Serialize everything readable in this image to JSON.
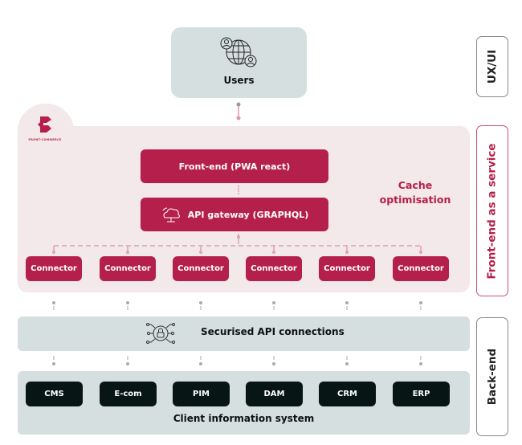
{
  "colors": {
    "brand": "#b51f4b",
    "brand_panel": "#f3e8ea",
    "neutral_panel": "#d5dfdf",
    "system_box": "#071514"
  },
  "layers": {
    "ux": "UX/UI",
    "front": "Front-end as a service",
    "back": "Back-end"
  },
  "users": {
    "label": "Users",
    "icon": "globe-users-icon"
  },
  "brand_logo": {
    "text": "FRONT-COMMERCE",
    "icon": "front-commerce-logo-icon"
  },
  "frontend": {
    "label": "Front-end (PWA react)"
  },
  "gateway": {
    "label": "API gateway (GRAPHQL)",
    "icon": "cloud-network-icon"
  },
  "cache": {
    "line1": "Cache",
    "line2": "optimisation"
  },
  "connectors": [
    "Connector",
    "Connector",
    "Connector",
    "Connector",
    "Connector",
    "Connector"
  ],
  "api": {
    "label": "Securised API connections",
    "icon": "lock-network-icon"
  },
  "systems": [
    "CMS",
    "E-com",
    "PIM",
    "DAM",
    "CRM",
    "ERP"
  ],
  "client_system": {
    "label": "Client information system"
  }
}
